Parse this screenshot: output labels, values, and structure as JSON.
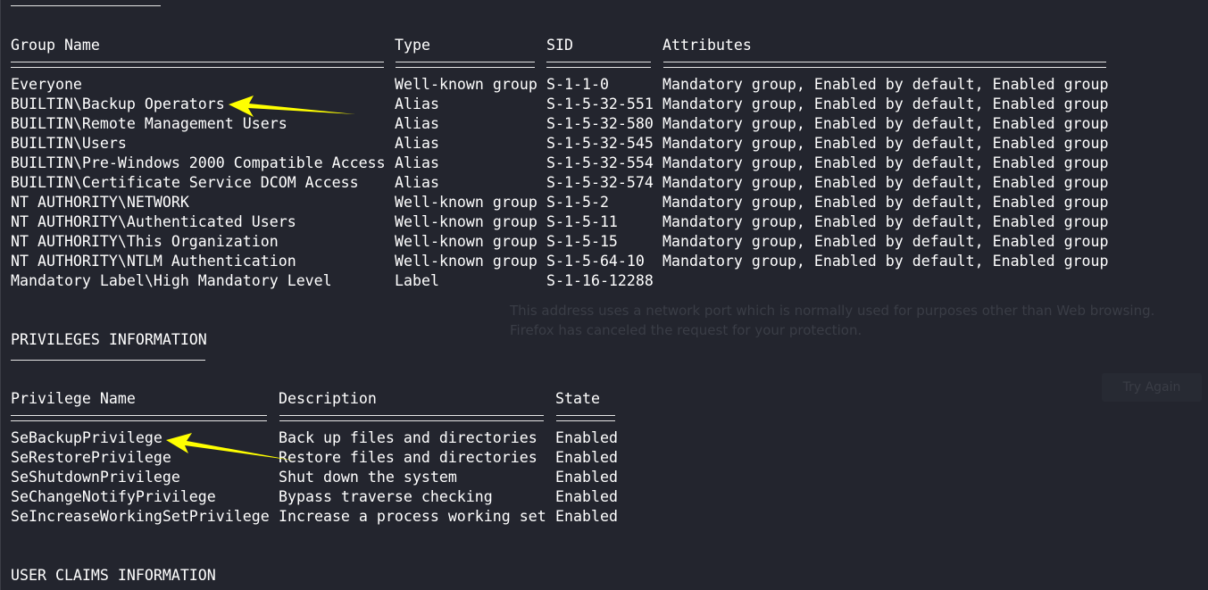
{
  "groups": {
    "headers": [
      "Group Name",
      "Type",
      "SID",
      "Attributes"
    ],
    "rows": [
      {
        "name": "Everyone",
        "type": "Well-known group",
        "sid": "S-1-1-0",
        "attributes": "Mandatory group, Enabled by default, Enabled group"
      },
      {
        "name": "BUILTIN\\Backup Operators",
        "type": "Alias",
        "sid": "S-1-5-32-551",
        "attributes": "Mandatory group, Enabled by default, Enabled group"
      },
      {
        "name": "BUILTIN\\Remote Management Users",
        "type": "Alias",
        "sid": "S-1-5-32-580",
        "attributes": "Mandatory group, Enabled by default, Enabled group"
      },
      {
        "name": "BUILTIN\\Users",
        "type": "Alias",
        "sid": "S-1-5-32-545",
        "attributes": "Mandatory group, Enabled by default, Enabled group"
      },
      {
        "name": "BUILTIN\\Pre-Windows 2000 Compatible Access",
        "type": "Alias",
        "sid": "S-1-5-32-554",
        "attributes": "Mandatory group, Enabled by default, Enabled group"
      },
      {
        "name": "BUILTIN\\Certificate Service DCOM Access",
        "type": "Alias",
        "sid": "S-1-5-32-574",
        "attributes": "Mandatory group, Enabled by default, Enabled group"
      },
      {
        "name": "NT AUTHORITY\\NETWORK",
        "type": "Well-known group",
        "sid": "S-1-5-2",
        "attributes": "Mandatory group, Enabled by default, Enabled group"
      },
      {
        "name": "NT AUTHORITY\\Authenticated Users",
        "type": "Well-known group",
        "sid": "S-1-5-11",
        "attributes": "Mandatory group, Enabled by default, Enabled group"
      },
      {
        "name": "NT AUTHORITY\\This Organization",
        "type": "Well-known group",
        "sid": "S-1-5-15",
        "attributes": "Mandatory group, Enabled by default, Enabled group"
      },
      {
        "name": "NT AUTHORITY\\NTLM Authentication",
        "type": "Well-known group",
        "sid": "S-1-5-64-10",
        "attributes": "Mandatory group, Enabled by default, Enabled group"
      },
      {
        "name": "Mandatory Label\\High Mandatory Level",
        "type": "Label",
        "sid": "S-1-16-12288",
        "attributes": ""
      }
    ]
  },
  "privileges": {
    "section_title": "PRIVILEGES INFORMATION",
    "headers": [
      "Privilege Name",
      "Description",
      "State"
    ],
    "rows": [
      {
        "name": "SeBackupPrivilege",
        "description": "Back up files and directories",
        "state": "Enabled"
      },
      {
        "name": "SeRestorePrivilege",
        "description": "Restore files and directories",
        "state": "Enabled"
      },
      {
        "name": "SeShutdownPrivilege",
        "description": "Shut down the system",
        "state": "Enabled"
      },
      {
        "name": "SeChangeNotifyPrivilege",
        "description": "Bypass traverse checking",
        "state": "Enabled"
      },
      {
        "name": "SeIncreaseWorkingSetPrivilege",
        "description": "Increase a process working set",
        "state": "Enabled"
      }
    ]
  },
  "claims": {
    "section_title": "USER CLAIMS INFORMATION"
  },
  "background_overlay": {
    "message_line1": "This address uses a network port which is normally used for purposes other than Web browsing.",
    "message_line2": "Firefox has canceled the request for your protection.",
    "button_label": "Try Again"
  },
  "colors": {
    "terminal_bg": "#23252e",
    "text": "#ffffff",
    "annotation_arrow": "#ffff00"
  }
}
